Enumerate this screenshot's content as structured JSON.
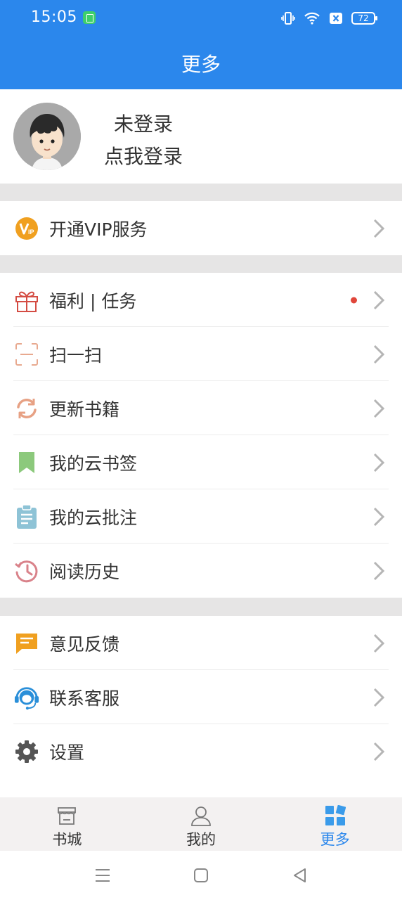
{
  "status_bar": {
    "time": "15:05",
    "battery": "72"
  },
  "header": {
    "title": "更多"
  },
  "profile": {
    "status": "未登录",
    "action": "点我登录"
  },
  "vip": {
    "label": "开通VIP服务"
  },
  "menu_group_1": [
    {
      "label": "福利 | 任务",
      "icon": "gift-icon"
    },
    {
      "label": "扫一扫",
      "icon": "scan-icon"
    },
    {
      "label": "更新书籍",
      "icon": "refresh-icon"
    },
    {
      "label": "我的云书签",
      "icon": "bookmark-icon"
    },
    {
      "label": "我的云批注",
      "icon": "clipboard-icon"
    },
    {
      "label": "阅读历史",
      "icon": "history-icon"
    }
  ],
  "menu_group_2": [
    {
      "label": "意见反馈",
      "icon": "feedback-icon"
    },
    {
      "label": "联系客服",
      "icon": "headset-icon"
    },
    {
      "label": "设置",
      "icon": "gear-icon"
    }
  ],
  "bottom_nav": [
    {
      "label": "书城",
      "icon": "store-icon",
      "active": false
    },
    {
      "label": "我的",
      "icon": "person-icon",
      "active": false
    },
    {
      "label": "更多",
      "icon": "grid-icon",
      "active": true
    }
  ],
  "colors": {
    "accent": "#2b87ec",
    "vip": "#f0a020",
    "badge": "#e0463a"
  }
}
